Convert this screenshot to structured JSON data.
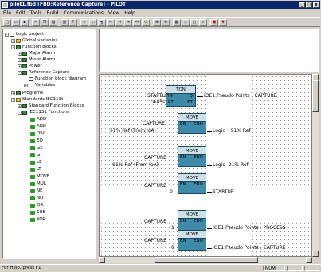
{
  "window": {
    "title": "pilot1.fbd [FBD:Reference Capture] - PILOT",
    "minimize_glyph": "_",
    "maximize_glyph": "□",
    "close_glyph": "x"
  },
  "menu": [
    "File",
    "Edit",
    "Tools",
    "Build",
    "Communications",
    "View",
    "Help"
  ],
  "toolbar_icons": [
    "new-icon",
    "open-icon",
    "save-icon",
    "cut-icon",
    "copy-icon",
    "paste-icon",
    "print-icon",
    "help-pointer-icon",
    "pointer-icon",
    "block-icon",
    "wire-icon",
    "input-icon",
    "output-icon",
    "connector-icon",
    "label-icon",
    "jump-icon",
    "zoom-in-icon",
    "zoom-out-icon",
    "grid-icon",
    "align-icon",
    "comment-icon",
    "find-icon",
    "compile-icon",
    "download-icon"
  ],
  "tree": {
    "root": "Logic project",
    "global_variables": "Global variables",
    "function_blocks": "Function blocks",
    "major_alarm": "Major Alarm",
    "minor_alarm": "Minor Alarm",
    "power": "Power",
    "reference_capture": "Reference Capture",
    "function_block_diagram": "Function block diagram",
    "variables": "Variables",
    "programs": "Programs",
    "standards": "Standards IEC113t",
    "standard_function_blocks": "Standard Function Blocks",
    "iec1131_functions": "IEC1131 Functions",
    "functions": [
      "ADD",
      "AND",
      "DIV",
      "EQ",
      "GE",
      "GT",
      "LE",
      "LT",
      "MOVE",
      "MUL",
      "NE",
      "NOT",
      "OR",
      "SUB",
      "XOR"
    ]
  },
  "diagram": {
    "ton": {
      "title": "TON",
      "in": "IN",
      "q": "Q",
      "pt": "PT",
      "et": "ET",
      "in_var": "STARTUP",
      "pt_var": "t#45s",
      "q_var": "IOE1:Pseudo Points : CAPTURE"
    },
    "moves": [
      {
        "title": "MOVE",
        "en": "EN",
        "eno": "ENO",
        "en_var": "CAPTURE",
        "in_var": "+91% Ref (From IoA)",
        "out_var": "Logic +91% Ref"
      },
      {
        "title": "MOVE",
        "en": "EN",
        "eno": "ENO",
        "en_var": "CAPTURE",
        "in_var": "-91% Ref (From IoA)",
        "out_var": "Logic -91% Ref"
      },
      {
        "title": "MOVE",
        "en": "EN",
        "eno": "ENO",
        "en_var": "CAPTURE",
        "in_var": "0",
        "out_var": "STARTUP"
      },
      {
        "title": "MOVE",
        "en": "EN",
        "eno": "ENO",
        "en_var": "CAPTURE",
        "in_var": "1",
        "out_var": "IOE1:Pseudo Points : PROCESS"
      },
      {
        "title": "MOVE",
        "en": "EN",
        "eno": "ENO",
        "en_var": "CAPTURE",
        "in_var": "0",
        "out_var": "IOE1:Pseudo Points : CAPTURE"
      }
    ]
  },
  "statusbar": {
    "text": "For Help, press F1",
    "num": "NUM"
  }
}
